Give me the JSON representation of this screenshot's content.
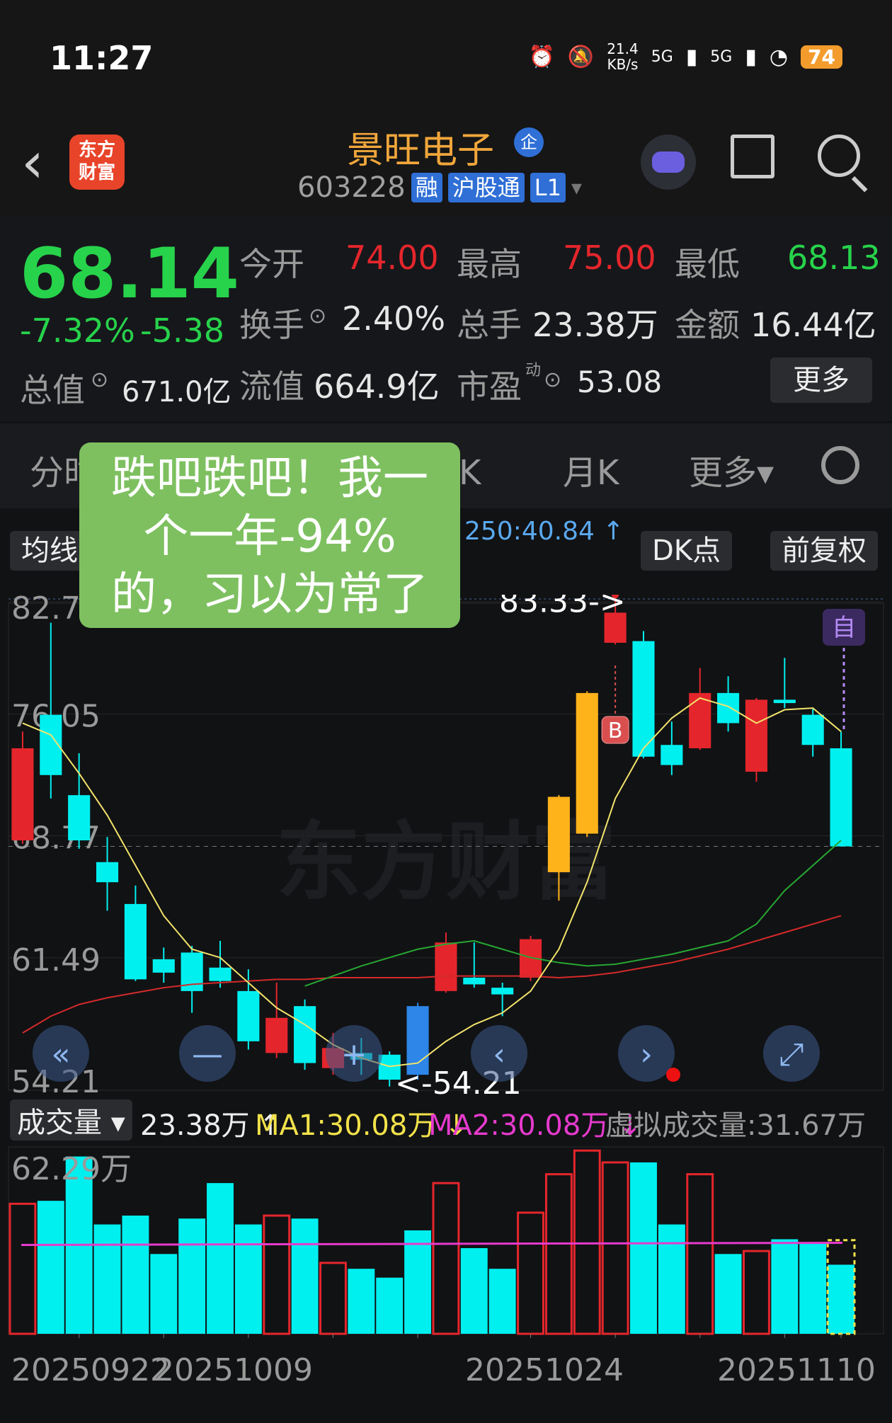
{
  "status_bar": {
    "time": "11:27",
    "speed": "21.4\nKB/s",
    "net1": "5G",
    "net2": "5G",
    "battery": "74"
  },
  "header": {
    "back": "‹",
    "logo_line1": "东方",
    "logo_line2": "财富",
    "stock_name": "景旺电子",
    "badge": "企",
    "code": "603228",
    "tags": [
      "融",
      "沪股通",
      "L1"
    ]
  },
  "quote": {
    "price": "68.14",
    "change_pct": "-7.32%",
    "change_amt": "-5.38",
    "market_cap_label": "总值",
    "market_cap": "671.0亿",
    "open_label": "今开",
    "open": "74.00",
    "high_label": "最高",
    "high": "75.00",
    "low_label": "最低",
    "low": "68.13",
    "turnover_label": "换手",
    "turnover": "2.40%",
    "volume_label": "总手",
    "volume": "23.38万",
    "amount_label": "金额",
    "amount": "16.44亿",
    "float_label": "流值",
    "float_cap": "664.9亿",
    "pe_label": "市盈",
    "pe_sup": "动",
    "pe": "53.08",
    "more": "更多"
  },
  "tabs": {
    "t1": "分时",
    "t2": "日K",
    "t3": "月K",
    "t4": "更多▾"
  },
  "toolbar": {
    "ma_chip": "均线",
    "ma_text": "250:40.84 ↑",
    "dk": "DK点",
    "fq": "前复权"
  },
  "overlay": {
    "line1": "跌吧跌吧！我一",
    "line2": "个一年-94%",
    "line3": "的，习以为常了"
  },
  "chart": {
    "y_labels": [
      "82.75",
      "76.05",
      "68.77",
      "61.49",
      "54.21"
    ],
    "high_marker": "83.33->",
    "low_marker": "<-54.21",
    "b_marker": "B",
    "self_marker": "自",
    "watermark": "东方财富"
  },
  "volume": {
    "selector": "成交量",
    "value": "23.38万 ↑",
    "ma1": "MA1:30.08万 ↓",
    "ma2": "MA2:30.08万 ↓",
    "virtual": "虚拟成交量:31.67万",
    "max_label": "62.29万"
  },
  "dates": [
    "20250922",
    "20251009",
    "20251024",
    "20251110"
  ],
  "colors": {
    "up": "#e4262c",
    "down": "#00f0f0",
    "accent": "#f1a63b",
    "ma5": "#f2e36b",
    "ma10": "#26a732",
    "ma20": "#d42a2a"
  },
  "chart_data": {
    "type": "candlestick",
    "ylim": [
      54.21,
      82.75
    ],
    "candles": [
      {
        "o": 74.0,
        "c": 68.5,
        "h": 75.0,
        "l": 68.3,
        "dir": "up"
      },
      {
        "o": 76.0,
        "c": 72.4,
        "h": 81.5,
        "l": 71.0,
        "dir": "down"
      },
      {
        "o": 71.2,
        "c": 68.5,
        "h": 73.7,
        "l": 68.0,
        "dir": "down"
      },
      {
        "o": 67.2,
        "c": 66.0,
        "h": 68.7,
        "l": 64.3,
        "dir": "down"
      },
      {
        "o": 64.7,
        "c": 60.2,
        "h": 65.8,
        "l": 60.1,
        "dir": "down"
      },
      {
        "o": 61.4,
        "c": 60.6,
        "h": 62.1,
        "l": 60.0,
        "dir": "down"
      },
      {
        "o": 61.8,
        "c": 59.5,
        "h": 62.2,
        "l": 58.2,
        "dir": "down"
      },
      {
        "o": 60.9,
        "c": 60.1,
        "h": 62.5,
        "l": 59.7,
        "dir": "down"
      },
      {
        "o": 59.5,
        "c": 56.5,
        "h": 60.8,
        "l": 56.0,
        "dir": "down"
      },
      {
        "o": 55.8,
        "c": 57.9,
        "h": 60.0,
        "l": 55.5,
        "dir": "up"
      },
      {
        "o": 58.6,
        "c": 55.2,
        "h": 59.0,
        "l": 54.8,
        "dir": "down"
      },
      {
        "o": 54.9,
        "c": 56.1,
        "h": 57.0,
        "l": 54.5,
        "dir": "up"
      },
      {
        "o": 55.8,
        "c": 55.4,
        "h": 56.7,
        "l": 54.5,
        "dir": "down"
      },
      {
        "o": 55.7,
        "c": 54.21,
        "h": 55.9,
        "l": 53.8,
        "dir": "down"
      },
      {
        "o": 58.6,
        "c": 54.5,
        "h": 58.8,
        "l": 54.2,
        "dir": "down"
      },
      {
        "o": 59.5,
        "c": 62.4,
        "h": 63.0,
        "l": 59.4,
        "dir": "up"
      },
      {
        "o": 60.3,
        "c": 59.9,
        "h": 62.4,
        "l": 59.7,
        "dir": "down"
      },
      {
        "o": 59.7,
        "c": 59.3,
        "h": 60.0,
        "l": 58.0,
        "dir": "down"
      },
      {
        "o": 60.3,
        "c": 62.6,
        "h": 62.8,
        "l": 60.1,
        "dir": "up"
      },
      {
        "o": 66.6,
        "c": 71.1,
        "h": 71.2,
        "l": 64.9,
        "dir": "up"
      },
      {
        "o": 68.9,
        "c": 77.3,
        "h": 77.4,
        "l": 68.7,
        "dir": "up"
      },
      {
        "o": 80.3,
        "c": 82.1,
        "h": 83.33,
        "l": 80.2,
        "dir": "up"
      },
      {
        "o": 80.4,
        "c": 73.5,
        "h": 81.0,
        "l": 73.4,
        "dir": "down"
      },
      {
        "o": 74.2,
        "c": 73.0,
        "h": 75.6,
        "l": 72.4,
        "dir": "down"
      },
      {
        "o": 74.0,
        "c": 77.3,
        "h": 78.8,
        "l": 73.9,
        "dir": "up"
      },
      {
        "o": 77.3,
        "c": 75.5,
        "h": 78.3,
        "l": 75.0,
        "dir": "down"
      },
      {
        "o": 72.6,
        "c": 76.9,
        "h": 77.0,
        "l": 72.0,
        "dir": "up"
      },
      {
        "o": 76.9,
        "c": 76.7,
        "h": 79.4,
        "l": 76.4,
        "dir": "down"
      },
      {
        "o": 76.0,
        "c": 74.2,
        "h": 76.4,
        "l": 73.5,
        "dir": "down"
      },
      {
        "o": 74.0,
        "c": 68.14,
        "h": 75.0,
        "l": 68.13,
        "dir": "down"
      }
    ],
    "ma5": [
      75.5,
      74.8,
      72.5,
      70.0,
      67.0,
      64.0,
      62.0,
      61.5,
      60.0,
      58.5,
      57.5,
      56.3,
      55.5,
      55.0,
      55.2,
      56.5,
      57.5,
      58.2,
      59.5,
      62.0,
      66.0,
      71.0,
      74.0,
      75.8,
      77.0,
      76.5,
      75.5,
      76.3,
      76.4,
      75.0
    ],
    "ma10": [
      null,
      null,
      null,
      null,
      null,
      null,
      null,
      null,
      null,
      null,
      59.8,
      60.4,
      61.0,
      61.5,
      62.0,
      62.3,
      62.5,
      62.0,
      61.5,
      61.2,
      61.0,
      61.1,
      61.4,
      61.7,
      62.1,
      62.5,
      63.5,
      65.5,
      67.0,
      68.5
    ],
    "ma20": [
      57.0,
      58.0,
      58.7,
      59.1,
      59.4,
      59.7,
      59.9,
      60.0,
      60.1,
      60.2,
      60.2,
      60.3,
      60.3,
      60.3,
      60.3,
      60.4,
      60.4,
      60.4,
      60.4,
      60.3,
      60.4,
      60.6,
      60.9,
      61.2,
      61.6,
      62.0,
      62.5,
      63.0,
      63.5,
      64.0
    ],
    "volume_max": 62.29,
    "volume": [
      44,
      45,
      60,
      37,
      40,
      27,
      39,
      51,
      37,
      40,
      39,
      24,
      22,
      19,
      35,
      51,
      29,
      22,
      41,
      54,
      62,
      58,
      58,
      37,
      54,
      27,
      28,
      32,
      31,
      23.38
    ]
  }
}
